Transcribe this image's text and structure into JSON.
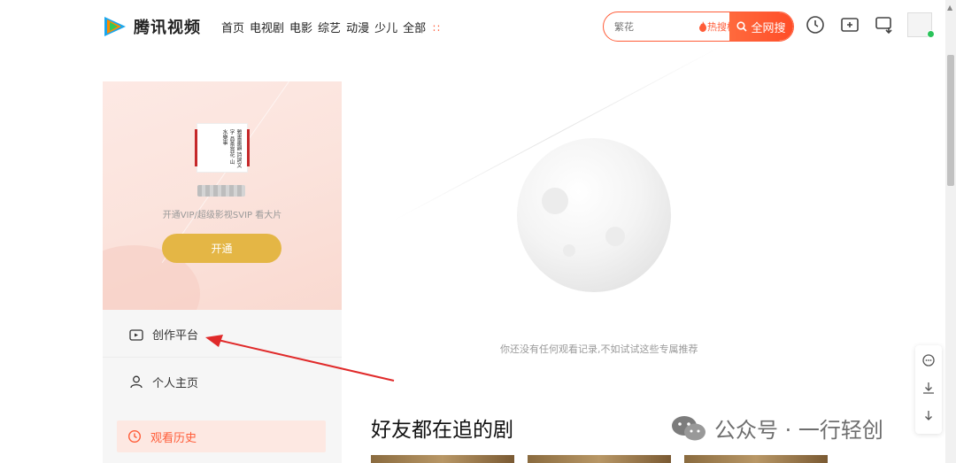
{
  "header": {
    "logo_text": "腾讯视频",
    "nav": [
      "首页",
      "电视剧",
      "电影",
      "综艺",
      "动漫",
      "少儿",
      "全部"
    ],
    "search": {
      "placeholder": "繁花",
      "hot_rank_label": "热搜榜",
      "button_label": "全网搜"
    },
    "icons": [
      "history-icon",
      "upload-icon",
      "screen-icon",
      "avatar"
    ]
  },
  "sidebar": {
    "vip_text": "开通VIP/超级影视SVIP 看大片",
    "open_button": "开通",
    "menu": {
      "create": "创作平台",
      "home": "个人主页",
      "history": "观看历史"
    }
  },
  "main": {
    "empty_text": "你还没有任何观看记录,不如试试这些专属推荐",
    "friends_title": "好友都在追的剧"
  },
  "watermark": {
    "text": "公众号 · 一行轻创"
  },
  "colors": {
    "accent": "#ff5c38",
    "vip_gold": "#e4b645",
    "arrow": "#e02a2a"
  }
}
